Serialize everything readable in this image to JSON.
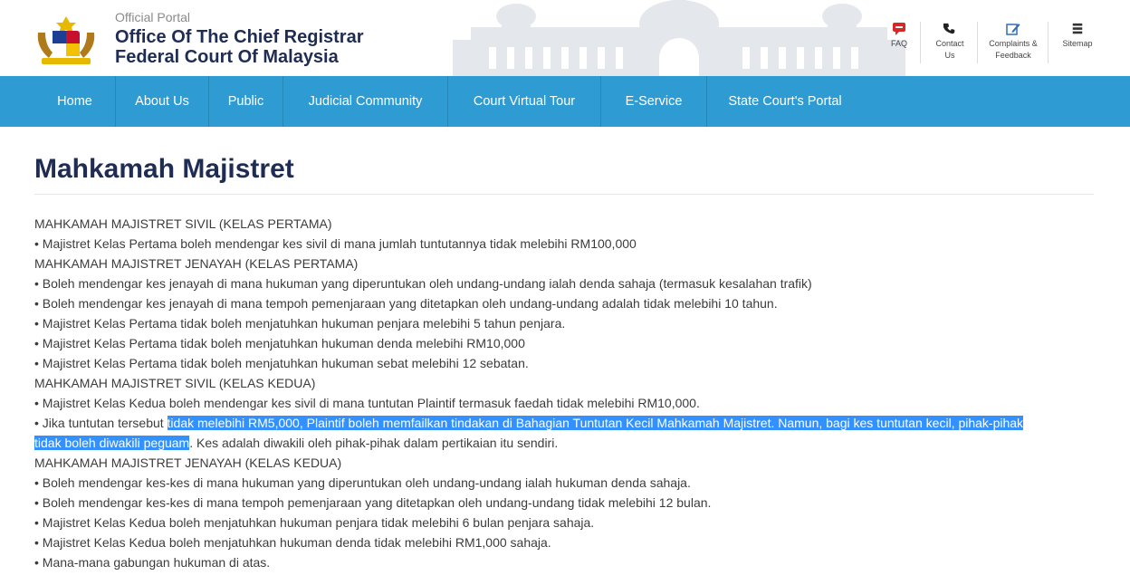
{
  "header": {
    "portal_label": "Official Portal",
    "title_line1": "Office Of The Chief Registrar",
    "title_line2": "Federal Court Of Malaysia",
    "utilities": {
      "faq": "FAQ",
      "contact_line1": "Contact",
      "contact_line2": "Us",
      "complaints_line1": "Complaints &",
      "complaints_line2": "Feedback",
      "sitemap": "Sitemap"
    }
  },
  "nav": {
    "items": [
      "Home",
      "About Us",
      "Public",
      "Judicial Community",
      "Court Virtual Tour",
      "E-Service",
      "State Court's Portal"
    ]
  },
  "page": {
    "title": "Mahkamah Majistret",
    "lines": [
      "MAHKAMAH MAJISTRET SIVIL (KELAS PERTAMA)",
      "• Majistret Kelas Pertama boleh mendengar kes sivil di mana jumlah tuntutannya tidak melebihi RM100,000",
      "MAHKAMAH MAJISTRET JENAYAH (KELAS PERTAMA)",
      "• Boleh mendengar kes jenayah di mana hukuman yang diperuntukan oleh undang-undang ialah denda sahaja (termasuk kesalahan trafik)",
      "• Boleh mendengar kes jenayah di mana tempoh pemenjaraan yang ditetapkan oleh undang-undang adalah tidak melebihi 10 tahun.",
      "• Majistret Kelas Pertama tidak boleh menjatuhkan hukuman penjara melebihi 5 tahun penjara.",
      "• Majistret Kelas Pertama tidak boleh menjatuhkan hukuman denda melebihi RM10,000",
      "• Majistret Kelas Pertama tidak boleh menjatuhkan hukuman sebat melebihi 12 sebatan.",
      "MAHKAMAH MAJISTRET SIVIL (KELAS KEDUA)",
      "• Majistret Kelas Kedua boleh mendengar kes sivil di mana tuntutan Plaintif termasuk faedah tidak melebihi RM10,000."
    ],
    "selection_paragraph": {
      "before": "• Jika tuntutan tersebut ",
      "highlighted_line1": "tidak melebihi RM5,000, Plaintif boleh memfailkan tindakan di Bahagian Tuntutan Kecil Mahkamah Majistret. Namun, bagi kes tuntutan kecil, pihak-pihak",
      "highlighted_line2": "tidak boleh diwakili peguam",
      "after": ". Kes adalah diwakili oleh pihak-pihak dalam pertikaian itu sendiri."
    },
    "lines_after": [
      "MAHKAMAH MAJISTRET JENAYAH (KELAS KEDUA)",
      "• Boleh mendengar kes-kes di mana hukuman yang diperuntukan oleh undang-undang ialah hukuman denda sahaja.",
      "• Boleh mendengar kes-kes di mana tempoh pemenjaraan yang ditetapkan oleh undang-undang tidak melebihi 12 bulan.",
      "• Majistret Kelas Kedua boleh menjatuhkan hukuman penjara tidak melebihi 6 bulan penjara sahaja.",
      "• Majistret Kelas Kedua boleh menjatuhkan hukuman denda tidak melebihi RM1,000 sahaja.",
      "• Mana-mana gabungan hukuman di atas."
    ]
  },
  "colors": {
    "nav_bg": "#2f9bd3",
    "title": "#1f2d55",
    "selection": "#3390ff"
  },
  "icons": [
    "coat-of-arms-logo",
    "faq-icon",
    "phone-icon",
    "feedback-icon",
    "sitemap-icon"
  ]
}
